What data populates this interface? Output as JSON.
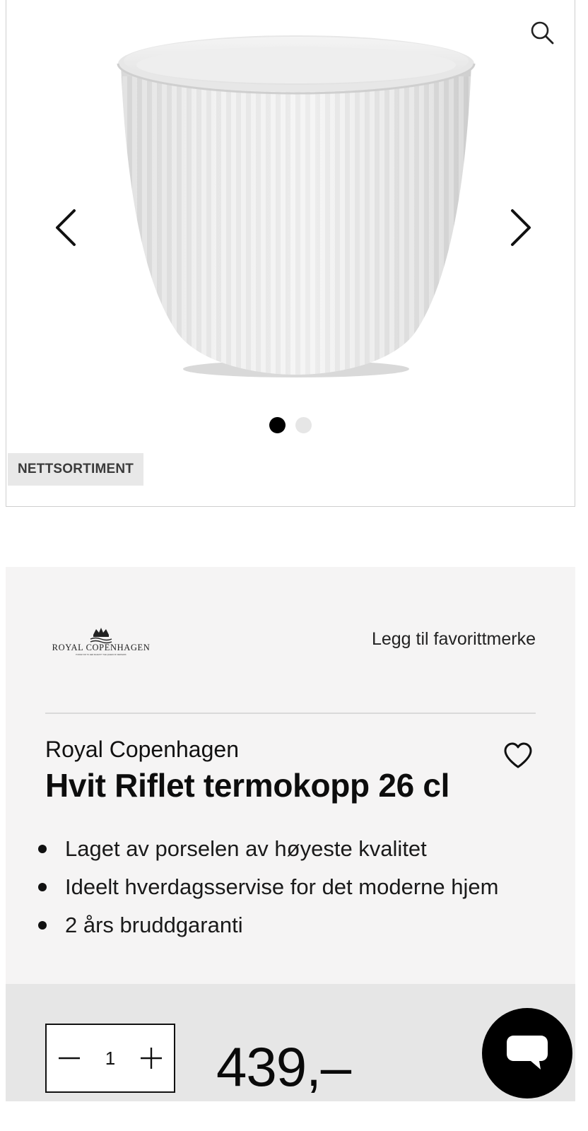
{
  "gallery": {
    "badge": "NETTSORTIMENT",
    "product_image_alt": "Hvit Riflet termokopp",
    "slide_count": 2,
    "active_slide": 1,
    "icons": {
      "zoom": "search-icon",
      "prev": "chevron-left-icon",
      "next": "chevron-right-icon"
    }
  },
  "info": {
    "brand_logo_text": "ROYAL COPENHAGEN",
    "brand_logo_subtext": "PURVEYOR TO HER MAJESTY THE QUEEN OF DENMARK",
    "favorite_brand_label": "Legg til favorittmerke",
    "brand": "Royal Copenhagen",
    "title": "Hvit Riflet termokopp 26 cl",
    "features": [
      "Laget av porselen av høyeste kvalitet",
      "Ideelt hverdagsservise for det moderne hjem",
      "2 års bruddgaranti"
    ]
  },
  "purchase": {
    "quantity": "1",
    "price": "439,–"
  },
  "colors": {
    "accent": "#000000",
    "card_background": "#f5f4f4",
    "buy_bar_background": "#e6e6e6",
    "badge_background": "#e8e8e8"
  }
}
